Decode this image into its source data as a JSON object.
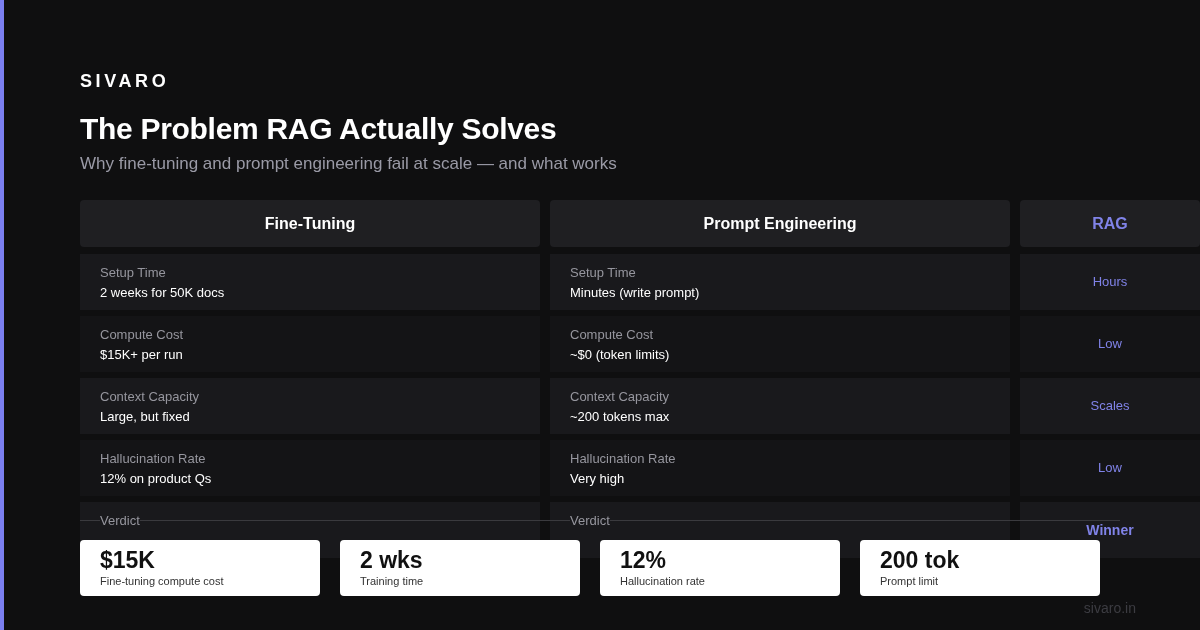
{
  "brand": "SIVARO",
  "title": "The Problem RAG Actually Solves",
  "subtitle": "Why fine-tuning and prompt engineering fail at scale — and what works",
  "table": {
    "columns": [
      {
        "label": "Fine-Tuning",
        "kind": "detail"
      },
      {
        "label": "Prompt Engineering",
        "kind": "detail"
      },
      {
        "label": "RAG",
        "kind": "highlight"
      }
    ],
    "rows": [
      {
        "cells": [
          {
            "label": "Setup Time",
            "value": "2 weeks for 50K docs"
          },
          {
            "label": "Setup Time",
            "value": "Minutes (write prompt)"
          },
          {
            "value": "Hours"
          }
        ]
      },
      {
        "cells": [
          {
            "label": "Compute Cost",
            "value": "$15K+ per run"
          },
          {
            "label": "Compute Cost",
            "value": "~$0 (token limits)"
          },
          {
            "value": "Low"
          }
        ]
      },
      {
        "cells": [
          {
            "label": "Context Capacity",
            "value": "Large, but fixed"
          },
          {
            "label": "Context Capacity",
            "value": "~200 tokens max"
          },
          {
            "value": "Scales"
          }
        ]
      },
      {
        "cells": [
          {
            "label": "Hallucination Rate",
            "value": "12% on product Qs"
          },
          {
            "label": "Hallucination Rate",
            "value": "Very high"
          },
          {
            "value": "Low"
          }
        ]
      },
      {
        "cells": [
          {
            "label": "Verdict"
          },
          {
            "label": "Verdict"
          },
          {
            "value": "Winner"
          }
        ]
      }
    ]
  },
  "stats": [
    {
      "value": "$15K",
      "label": "Fine-tuning compute cost"
    },
    {
      "value": "2 wks",
      "label": "Training time"
    },
    {
      "value": "12%",
      "label": "Hallucination rate"
    },
    {
      "value": "200 tok",
      "label": "Prompt limit"
    }
  ],
  "footer": "sivaro.in"
}
